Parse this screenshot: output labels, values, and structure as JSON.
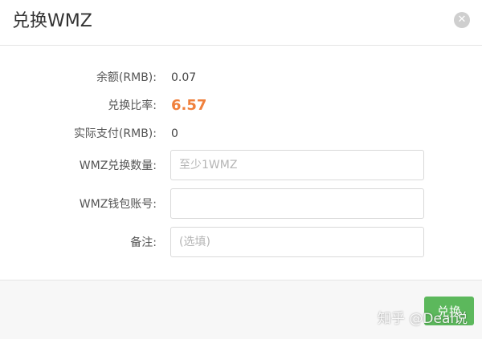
{
  "dialog": {
    "title": "兑换WMZ",
    "close_icon": "close-icon"
  },
  "form": {
    "balance_label": "余额(RMB):",
    "balance_value": "0.07",
    "rate_label": "兑换比率:",
    "rate_value": "6.57",
    "actual_pay_label": "实际支付(RMB):",
    "actual_pay_value": "0",
    "amount_label": "WMZ兑换数量:",
    "amount_placeholder": "至少1WMZ",
    "amount_value": "",
    "wallet_label": "WMZ钱包账号:",
    "wallet_placeholder": "",
    "wallet_value": "",
    "note_label": "备注:",
    "note_placeholder": "(选填)",
    "note_value": ""
  },
  "footer": {
    "submit_label": "兑换",
    "watermark": "知乎 @Deal说"
  },
  "colors": {
    "accent_rate": "#f0803c",
    "button_green": "#5cb85c"
  }
}
